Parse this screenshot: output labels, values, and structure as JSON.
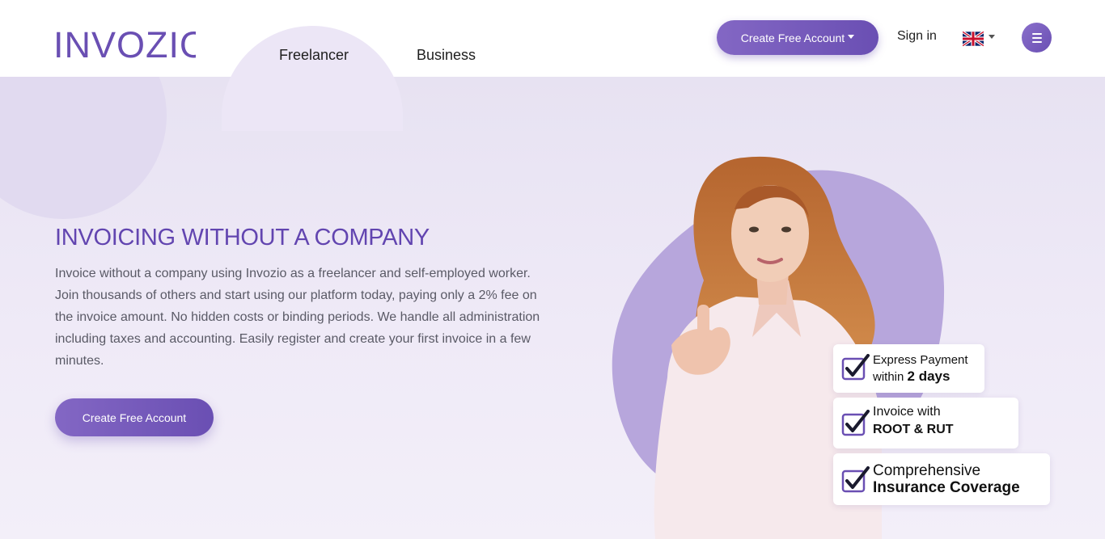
{
  "brand": {
    "name": "INVOZIO",
    "color": "#6a4fb3"
  },
  "nav": {
    "items": [
      {
        "label": "Freelancer"
      },
      {
        "label": "Business"
      }
    ],
    "cta_label": "Create Free Account",
    "signin_label": "Sign in",
    "language": "en-GB",
    "menu_icon": "hamburger-icon"
  },
  "hero": {
    "title": "INVOICING WITHOUT A COMPANY",
    "description": "Invoice without a company using Invozio as a freelancer and self-employed worker. Join thousands of others and start using our platform today, paying only a 2% fee on the invoice amount. No hidden costs or binding periods. We handle all administration including taxes and accounting. Easily register and create your first invoice in a few minutes.",
    "cta_label": "Create Free Account"
  },
  "badges": [
    {
      "line1": "Express Payment",
      "line2_prefix": "within ",
      "line2_bold": "2 days",
      "icon": "check-icon"
    },
    {
      "line1": "Invoice with",
      "line2": "ROOT & RUT",
      "icon": "check-icon"
    },
    {
      "line1": "Comprehensive",
      "line2": "Insurance Coverage",
      "icon": "check-icon"
    }
  ],
  "colors": {
    "accent": "#6a4fb3",
    "accent_light": "#8367c4",
    "hero_bg": "#ece7f5",
    "blob": "#b7a6dc",
    "title": "#6245b0"
  }
}
